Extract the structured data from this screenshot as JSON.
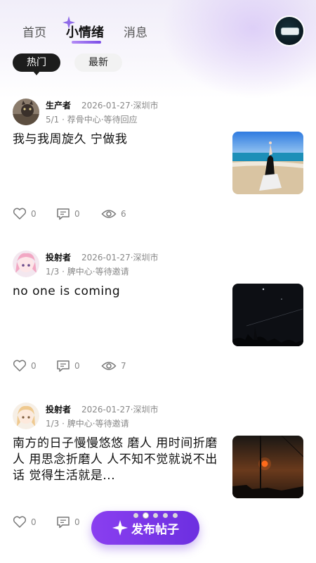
{
  "nav": {
    "tabs": [
      {
        "label": "首页"
      },
      {
        "label": "小情绪"
      },
      {
        "label": "消息"
      }
    ],
    "active_tab": "小情绪"
  },
  "filters": {
    "hot": "热门",
    "latest": "最新"
  },
  "posts": [
    {
      "author": "生产者",
      "meta": "2026-01-27·深圳市",
      "sub": "5/1 · 荐骨中心·等待回应",
      "title": "我与我周旋久 宁做我",
      "likes": "0",
      "comments": "0",
      "views": "6"
    },
    {
      "author": "投射者",
      "meta": "2026-01-27·深圳市",
      "sub": "1/3 · 脾中心·等待邀请",
      "title": "no one is coming",
      "likes": "0",
      "comments": "0",
      "views": "7"
    },
    {
      "author": "投射者",
      "meta": "2026-01-27·深圳市",
      "sub": "1/3 · 脾中心·等待邀请",
      "title": "南方的日子慢慢悠悠 磨人 用时间折磨人 用思念折磨人 人不知不觉就说不出话 觉得生活就是...",
      "likes": "0",
      "comments": "0"
    }
  ],
  "fab": {
    "label": "发布帖子"
  },
  "colors": {
    "accent": "#7b4ee6",
    "fab": "#8a3ff0"
  }
}
